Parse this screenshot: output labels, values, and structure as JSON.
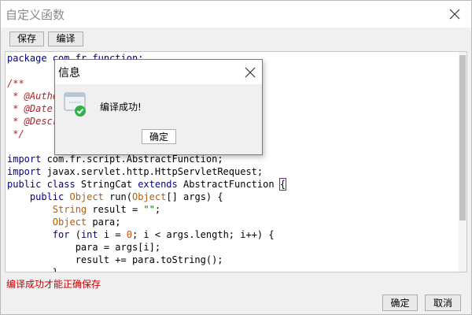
{
  "window": {
    "title": "自定义函数"
  },
  "toolbar": {
    "save_label": "保存",
    "compile_label": "编译"
  },
  "editor": {
    "lines": [
      [
        {
          "t": "package com.fr.function;",
          "c": "kw"
        }
      ],
      [],
      [
        {
          "t": "/**",
          "c": "cm"
        }
      ],
      [
        {
          "t": " * @Autho",
          "c": "cm"
        }
      ],
      [
        {
          "t": " * @Date:",
          "c": "cm"
        }
      ],
      [
        {
          "t": " * @Descr",
          "c": "cm"
        }
      ],
      [
        {
          "t": " */",
          "c": "cm"
        }
      ],
      [],
      [
        {
          "t": "import",
          "c": "kw"
        },
        {
          "t": " com.fr.script.AbstractFunction;",
          "c": ""
        }
      ],
      [
        {
          "t": "import",
          "c": "kw"
        },
        {
          "t": " javax.servlet.http.HttpServletRequest;",
          "c": ""
        }
      ],
      [
        {
          "t": "public class",
          "c": "kw"
        },
        {
          "t": " StringCat ",
          "c": ""
        },
        {
          "t": "extends",
          "c": "kw"
        },
        {
          "t": " AbstractFunction ",
          "c": ""
        },
        {
          "t": "{",
          "c": "brace"
        }
      ],
      [
        {
          "t": "    ",
          "c": ""
        },
        {
          "t": "public",
          "c": "kw"
        },
        {
          "t": " ",
          "c": ""
        },
        {
          "t": "Object",
          "c": "ty"
        },
        {
          "t": " run(",
          "c": ""
        },
        {
          "t": "Object",
          "c": "ty"
        },
        {
          "t": "[] args) {",
          "c": ""
        }
      ],
      [
        {
          "t": "        ",
          "c": ""
        },
        {
          "t": "String",
          "c": "ty"
        },
        {
          "t": " result = ",
          "c": ""
        },
        {
          "t": "\"\"",
          "c": "st"
        },
        {
          "t": ";",
          "c": ""
        }
      ],
      [
        {
          "t": "        ",
          "c": ""
        },
        {
          "t": "Object",
          "c": "ty"
        },
        {
          "t": " para;",
          "c": ""
        }
      ],
      [
        {
          "t": "        ",
          "c": ""
        },
        {
          "t": "for",
          "c": "kw"
        },
        {
          "t": " (",
          "c": ""
        },
        {
          "t": "int",
          "c": "kw"
        },
        {
          "t": " i = ",
          "c": ""
        },
        {
          "t": "0",
          "c": "nm"
        },
        {
          "t": "; i < args.length; i++) {",
          "c": ""
        }
      ],
      [
        {
          "t": "            para = args[i];",
          "c": ""
        }
      ],
      [
        {
          "t": "            result += para.toString();",
          "c": ""
        }
      ],
      [
        {
          "t": "        }",
          "c": ""
        }
      ]
    ]
  },
  "status": {
    "text": "编译成功才能正确保存"
  },
  "footer": {
    "ok_label": "确定",
    "cancel_label": "取消"
  },
  "dialog": {
    "title": "信息",
    "message": "编译成功!",
    "ok_label": "确定",
    "icon": "success-check-icon"
  },
  "colors": {
    "keyword": "#00008b",
    "type": "#b85c00",
    "comment": "#b22222",
    "string": "#008000",
    "status": "#cc0000",
    "success": "#2eb24c"
  }
}
